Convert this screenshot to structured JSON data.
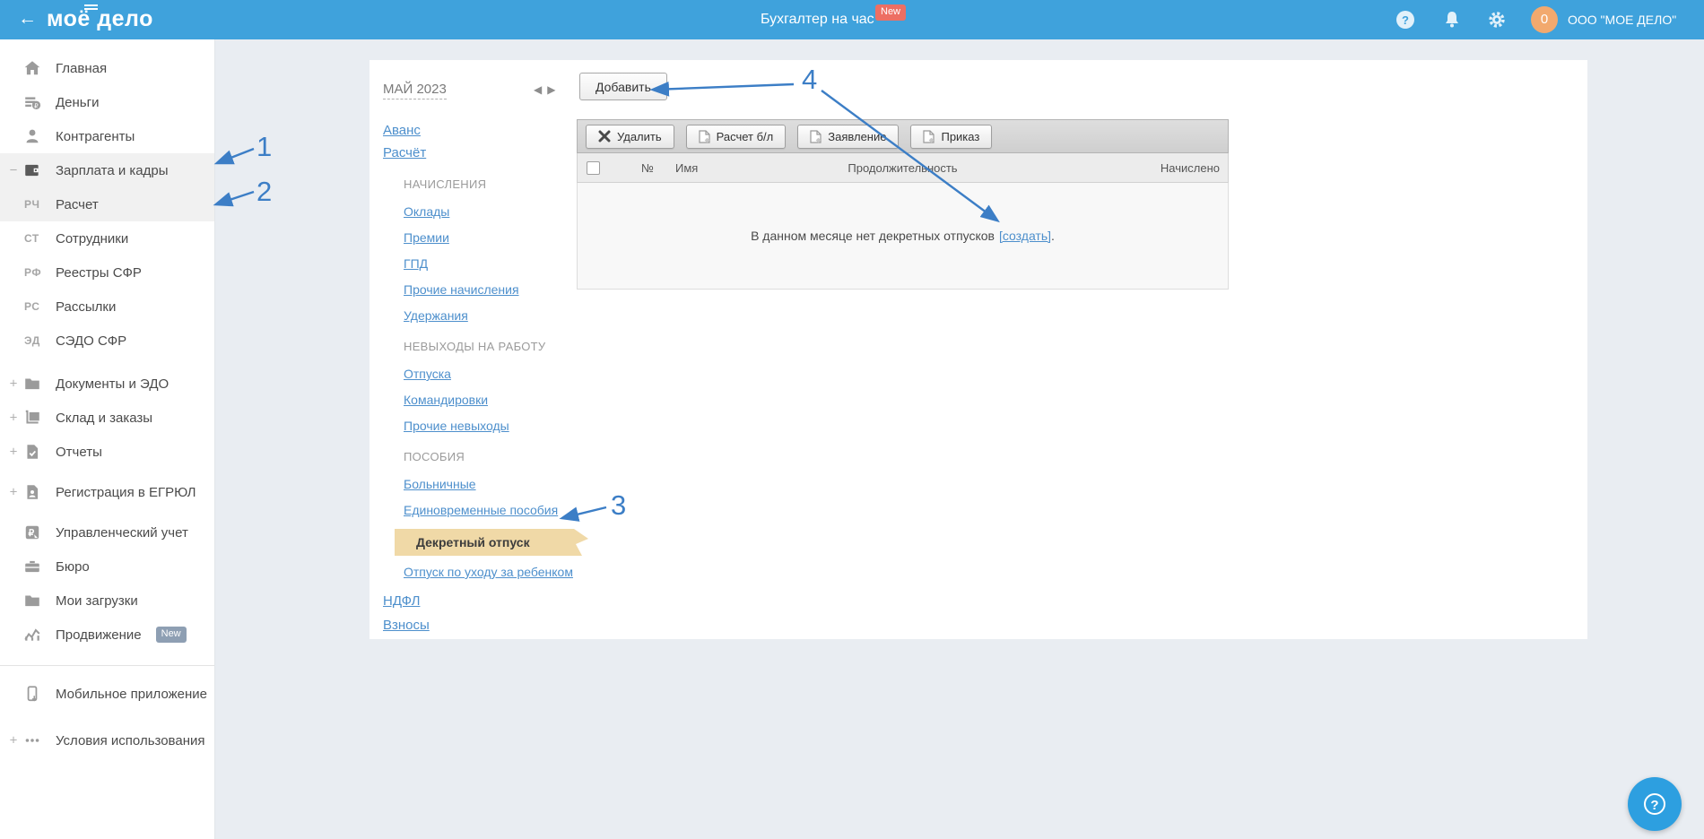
{
  "header": {
    "logo": "моё дело",
    "center_link": "Бухгалтер на час",
    "new_badge": "New",
    "avatar_initial": "0",
    "company": "ООО \"МОЕ ДЕЛО\"",
    "colors": {
      "bar": "#3fa2dc",
      "badge": "#ed6f63",
      "avatar": "#f2a96e"
    }
  },
  "sidebar": {
    "items": [
      {
        "label": "Главная",
        "icon": "home-icon"
      },
      {
        "label": "Деньги",
        "icon": "money-icon"
      },
      {
        "label": "Контрагенты",
        "icon": "person-icon"
      },
      {
        "label": "Зарплата и кадры",
        "icon": "wallet-icon",
        "expander": "−",
        "active": true
      },
      {
        "label": "Расчет",
        "code": "РЧ",
        "active": true
      },
      {
        "label": "Сотрудники",
        "code": "СТ"
      },
      {
        "label": "Реестры СФР",
        "code": "РФ"
      },
      {
        "label": "Рассылки",
        "code": "РС"
      },
      {
        "label": "СЭДО СФР",
        "code": "ЭД"
      },
      {
        "label": "Документы и ЭДО",
        "icon": "folder-icon",
        "expander": "+"
      },
      {
        "label": "Склад и заказы",
        "icon": "warehouse-icon",
        "expander": "+"
      },
      {
        "label": "Отчеты",
        "icon": "report-icon",
        "expander": "+"
      },
      {
        "label": "Регистрация в ЕГРЮЛ",
        "icon": "registration-icon",
        "expander": "+"
      },
      {
        "label": "Управленческий учет",
        "icon": "ruble-icon"
      },
      {
        "label": "Бюро",
        "icon": "briefcase-icon"
      },
      {
        "label": "Мои загрузки",
        "icon": "downloads-icon"
      },
      {
        "label": "Продвижение",
        "icon": "promotion-icon",
        "badge": "New"
      }
    ],
    "footer_items": [
      {
        "label": "Мобильное приложение",
        "icon": "mobile-icon"
      },
      {
        "label": "Условия использования",
        "icon": "dots-icon",
        "expander": "+"
      }
    ]
  },
  "content": {
    "month": "МАЙ 2023",
    "month_prev": "◀",
    "month_next": "▶",
    "add_button": "Добавить",
    "tabs": [
      "Аванс",
      "Расчёт"
    ],
    "nav": {
      "sections": [
        {
          "title": "НАЧИСЛЕНИЯ",
          "links": [
            "Оклады",
            "Премии",
            "ГПД",
            "Прочие начисления",
            "Удержания"
          ]
        },
        {
          "title": "НЕВЫХОДЫ НА РАБОТУ",
          "links": [
            "Отпуска",
            "Командировки",
            "Прочие невыходы"
          ]
        },
        {
          "title": "ПОСОБИЯ",
          "links": [
            "Больничные",
            "Единовременные пособия",
            "Декретный отпуск",
            "Отпуск по уходу за ребенком"
          ],
          "active_link": "Декретный отпуск"
        }
      ],
      "bottom_links": [
        "НДФЛ",
        "Взносы"
      ]
    },
    "table": {
      "toolbar": [
        "Удалить",
        "Расчет б/л",
        "Заявление",
        "Приказ"
      ],
      "columns": [
        "№",
        "Имя",
        "Продолжительность",
        "Начислено"
      ],
      "empty": {
        "text": "В данном месяце нет декретных отпусков",
        "link": "[создать]",
        "suffix": "."
      }
    },
    "highlight_color": "#f0d9a7",
    "link_color": "#4d8fcc"
  },
  "annotations": {
    "labels": [
      "1",
      "2",
      "3",
      "4"
    ],
    "color": "#3c7ec6"
  },
  "help_fab": {
    "glyph": "?"
  }
}
